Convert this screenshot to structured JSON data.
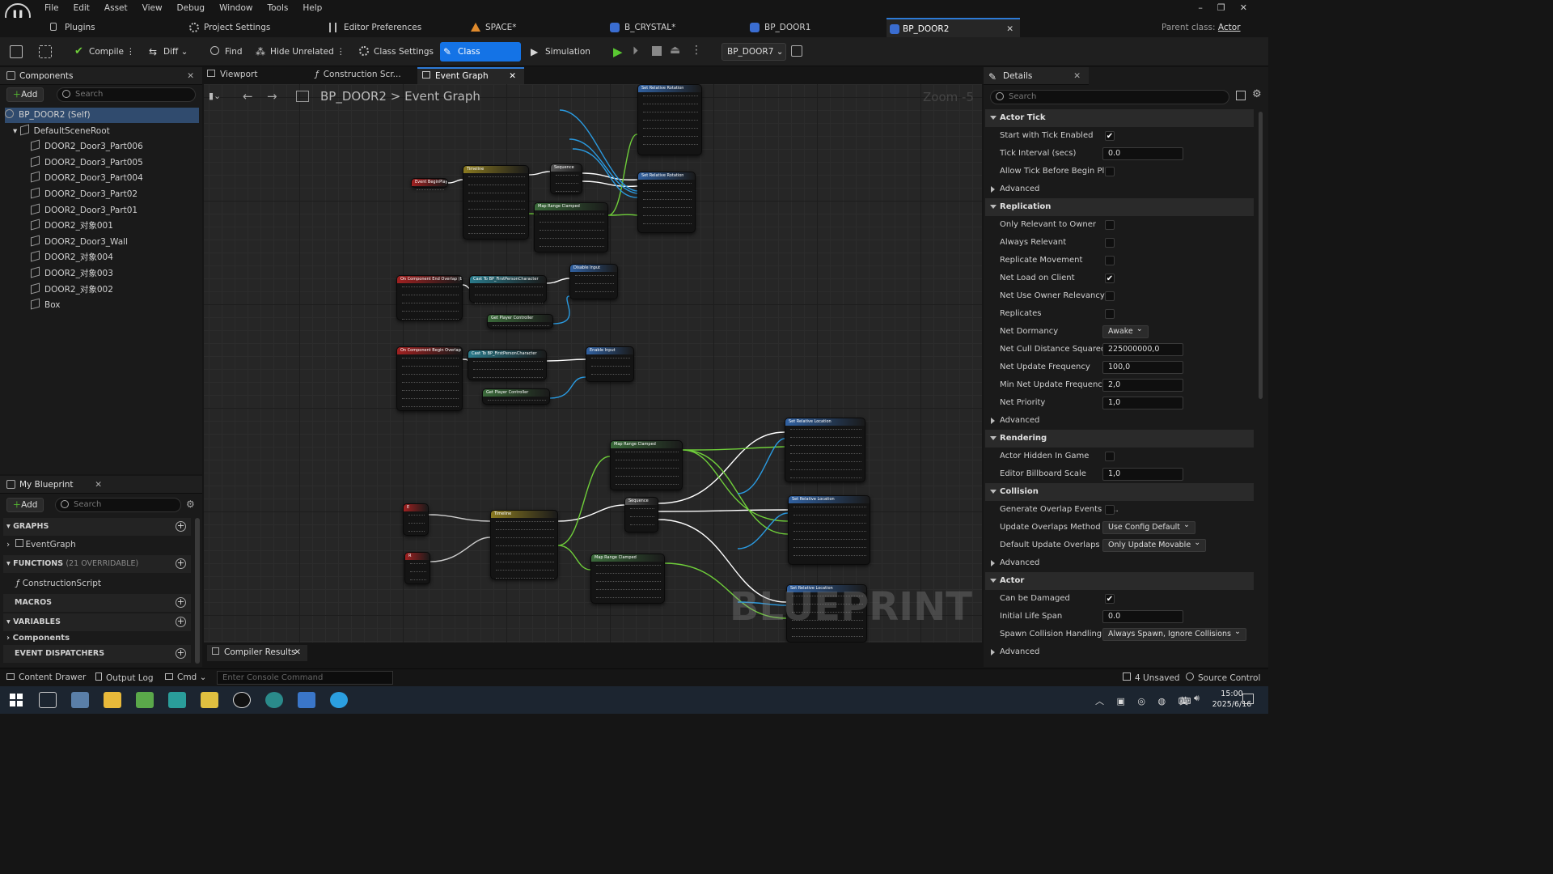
{
  "menu": [
    "File",
    "Edit",
    "Asset",
    "View",
    "Debug",
    "Window",
    "Tools",
    "Help"
  ],
  "tabs": [
    {
      "label": "Plugins",
      "icon": "plug-icon"
    },
    {
      "label": "Project Settings",
      "icon": "gear-icon"
    },
    {
      "label": "Editor Preferences",
      "icon": "sliders-icon"
    },
    {
      "label": "SPACE*",
      "icon": "level-icon"
    },
    {
      "label": "B_CRYSTAL*",
      "icon": "blueprint-icon"
    },
    {
      "label": "BP_DOOR1",
      "icon": "blueprint-icon"
    },
    {
      "label": "BP_DOOR2",
      "icon": "blueprint-icon"
    }
  ],
  "window": {
    "parent_class_label": "Parent class:",
    "parent_class_value": "Actor"
  },
  "toolbar": {
    "compile": "Compile",
    "diff": "Diff",
    "find": "Find",
    "hide_unrelated": "Hide Unrelated",
    "class_settings": "Class Settings",
    "class_defaults": "Class Defaults",
    "simulation": "Simulation",
    "debug_object": "BP_DOOR7"
  },
  "components": {
    "title": "Components",
    "add": "Add",
    "search_placeholder": "Search",
    "items": [
      "BP_DOOR2 (Self)",
      "DefaultSceneRoot",
      "DOOR2_Door3_Part006",
      "DOOR2_Door3_Part005",
      "DOOR2_Door3_Part004",
      "DOOR2_Door3_Part02",
      "DOOR2_Door3_Part01",
      "DOOR2_对象001",
      "DOOR2_Door3_Wall",
      "DOOR2_对象004",
      "DOOR2_对象003",
      "DOOR2_对象002",
      "Box"
    ]
  },
  "my_blueprint": {
    "title": "My Blueprint",
    "add": "Add",
    "search_placeholder": "Search",
    "graphs": "GRAPHS",
    "graph_item": "EventGraph",
    "functions": "FUNCTIONS",
    "functions_note": "(21 OVERRIDABLE)",
    "function_item": "ConstructionScript",
    "macros": "MACROS",
    "variables": "VARIABLES",
    "variables_item": "Components",
    "dispatchers": "EVENT DISPATCHERS"
  },
  "editor_tabs": [
    "Viewport",
    "Construction Scr...",
    "Event Graph"
  ],
  "graph": {
    "breadcrumb_root": "BP_DOOR2",
    "breadcrumb_sep": ">",
    "breadcrumb_leaf": "Event Graph",
    "zoom": "Zoom -5",
    "watermark": "BLUEPRINT",
    "nodes": {
      "begin_play": "Event BeginPlay",
      "timeline": "Timeline",
      "sequence": "Sequence",
      "map_range": "Map Range Clamped",
      "set_rel_rot": "Set Relative Rotation",
      "end_overlap": "On Component End Overlap (Box)",
      "begin_overlap": "On Component Begin Overlap (Box)",
      "cast": "Cast To BP_FirstPersonCharacter",
      "get_pc": "Get Player Controller",
      "disable_input": "Disable Input",
      "enable_input": "Enable Input",
      "set_rel_loc": "Set Relative Location",
      "key_e": "E",
      "key_r": "R"
    }
  },
  "compiler_results": "Compiler Results",
  "details": {
    "title": "Details",
    "search_placeholder": "Search",
    "sections": [
      {
        "name": "Actor Tick",
        "rows": [
          {
            "label": "Start with Tick Enabled",
            "type": "check",
            "value": true
          },
          {
            "label": "Tick Interval (secs)",
            "type": "num",
            "value": "0.0"
          },
          {
            "label": "Allow Tick Before Begin Pl...",
            "type": "check",
            "value": false
          }
        ]
      },
      {
        "name": "Replication",
        "rows": [
          {
            "label": "Only Relevant to Owner",
            "type": "check",
            "value": false
          },
          {
            "label": "Always Relevant",
            "type": "check",
            "value": false
          },
          {
            "label": "Replicate Movement",
            "type": "check",
            "value": false
          },
          {
            "label": "Net Load on Client",
            "type": "check",
            "value": true
          },
          {
            "label": "Net Use Owner Relevancy",
            "type": "check",
            "value": false
          },
          {
            "label": "Replicates",
            "type": "check",
            "value": false
          },
          {
            "label": "Net Dormancy",
            "type": "select",
            "value": "Awake"
          },
          {
            "label": "Net Cull Distance Squared",
            "type": "num",
            "value": "225000000,0"
          },
          {
            "label": "Net Update Frequency",
            "type": "num",
            "value": "100,0"
          },
          {
            "label": "Min Net Update Frequency",
            "type": "num",
            "value": "2,0"
          },
          {
            "label": "Net Priority",
            "type": "num",
            "value": "1,0"
          }
        ]
      },
      {
        "name": "Rendering",
        "rows": [
          {
            "label": "Actor Hidden In Game",
            "type": "check",
            "value": false
          },
          {
            "label": "Editor Billboard Scale",
            "type": "num",
            "value": "1,0"
          }
        ]
      },
      {
        "name": "Collision",
        "rows": [
          {
            "label": "Generate Overlap Events D...",
            "type": "check",
            "value": false
          },
          {
            "label": "Update Overlaps Method D...",
            "type": "select",
            "value": "Use Config Default"
          },
          {
            "label": "Default Update Overlaps M...",
            "type": "select",
            "value": "Only Update Movable"
          }
        ]
      },
      {
        "name": "Actor",
        "rows": [
          {
            "label": "Can be Damaged",
            "type": "check",
            "value": true
          },
          {
            "label": "Initial Life Span",
            "type": "num",
            "value": "0.0"
          },
          {
            "label": "Spawn Collision Handling...",
            "type": "select",
            "value": "Always Spawn, Ignore Collisions"
          }
        ]
      }
    ],
    "advanced": "Advanced"
  },
  "status": {
    "content_drawer": "Content Drawer",
    "output_log": "Output Log",
    "cmd": "Cmd",
    "console_placeholder": "Enter Console Command",
    "unsaved": "4 Unsaved",
    "source_control": "Source Control"
  },
  "taskbar": {
    "time": "15:00",
    "date": "2025/6/16",
    "ime": "英"
  }
}
